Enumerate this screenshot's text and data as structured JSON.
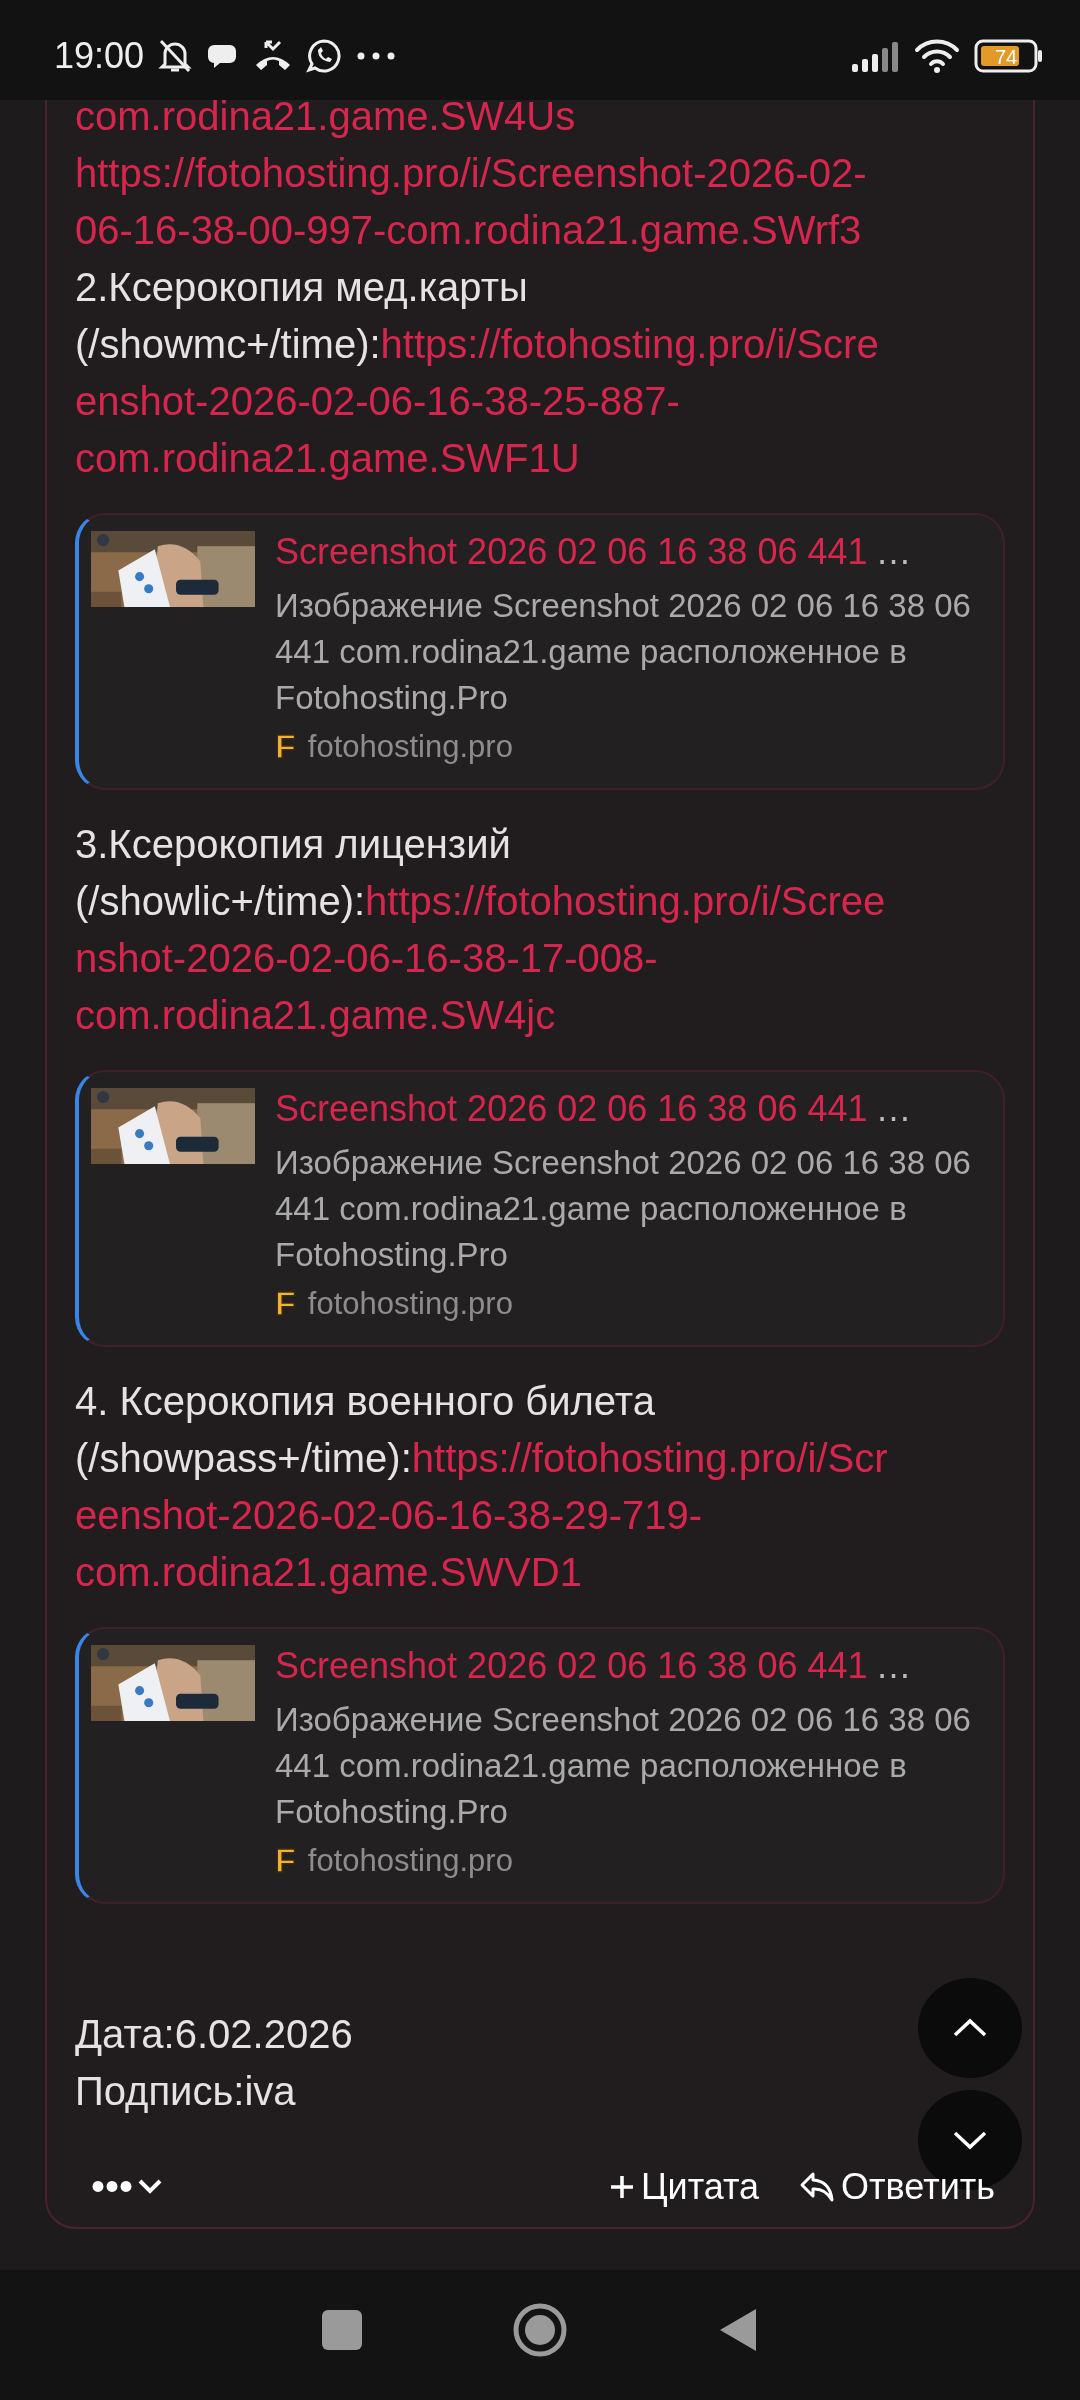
{
  "status_bar": {
    "time": "19:00",
    "battery": "74"
  },
  "post": {
    "blocks": [
      {
        "kind": "text",
        "lines": [
          {
            "link": "com.rodina21.game.SW4Us"
          },
          {
            "link": "https://fotohosting.pro/i/Screenshot-2026-02-"
          },
          {
            "link": "06-16-38-00-997-com.rodina21.game.SWrf3"
          }
        ]
      },
      {
        "kind": "text",
        "lines": [
          {
            "text": "2.Ксерокопия мед.карты"
          },
          {
            "text": "(/showmc+/time):",
            "link": "https://fotohosting.pro/i/Scre"
          },
          {
            "link": "enshot-2026-02-06-16-38-25-887-"
          },
          {
            "link": "com.rodina21.game.SWF1U"
          }
        ]
      },
      {
        "kind": "preview",
        "title": "Screenshot 2026 02 06 16 38 06 441",
        "ellipsis": "…",
        "description": "Изображение Screenshot 2026 02 06 16 38 06 441 com.rodina21.game расположенное в Fotohosting.Pro",
        "favicon": "F",
        "site": "fotohosting.pro"
      },
      {
        "kind": "text",
        "lines": [
          {
            "text": "3.Ксерокопия лицензий"
          },
          {
            "text": "(/showlic+/time):",
            "link": "https://fotohosting.pro/i/Scree"
          },
          {
            "link": "nshot-2026-02-06-16-38-17-008-"
          },
          {
            "link": "com.rodina21.game.SW4jc"
          }
        ]
      },
      {
        "kind": "preview",
        "title": "Screenshot 2026 02 06 16 38 06 441",
        "ellipsis": "…",
        "description": "Изображение Screenshot 2026 02 06 16 38 06 441 com.rodina21.game расположенное в Fotohosting.Pro",
        "favicon": "F",
        "site": "fotohosting.pro"
      },
      {
        "kind": "text",
        "lines": [
          {
            "text": "4. Ксерокопия военного билета"
          },
          {
            "text": "(/showpass+/time):",
            "link": "https://fotohosting.pro/i/Scr"
          },
          {
            "link": "eenshot-2026-02-06-16-38-29-719-"
          },
          {
            "link": "com.rodina21.game.SWVD1"
          }
        ]
      },
      {
        "kind": "preview",
        "title": "Screenshot 2026 02 06 16 38 06 441",
        "ellipsis": "…",
        "description": "Изображение Screenshot 2026 02 06 16 38 06 441 com.rodina21.game расположенное в Fotohosting.Pro",
        "favicon": "F",
        "site": "fotohosting.pro"
      },
      {
        "kind": "gap"
      },
      {
        "kind": "text",
        "lines": [
          {
            "text": "Дата:6.02.2026"
          },
          {
            "text": "Подпись:iva"
          }
        ]
      }
    ],
    "more": "•••",
    "quote": "Цитата",
    "reply": "Ответить"
  }
}
